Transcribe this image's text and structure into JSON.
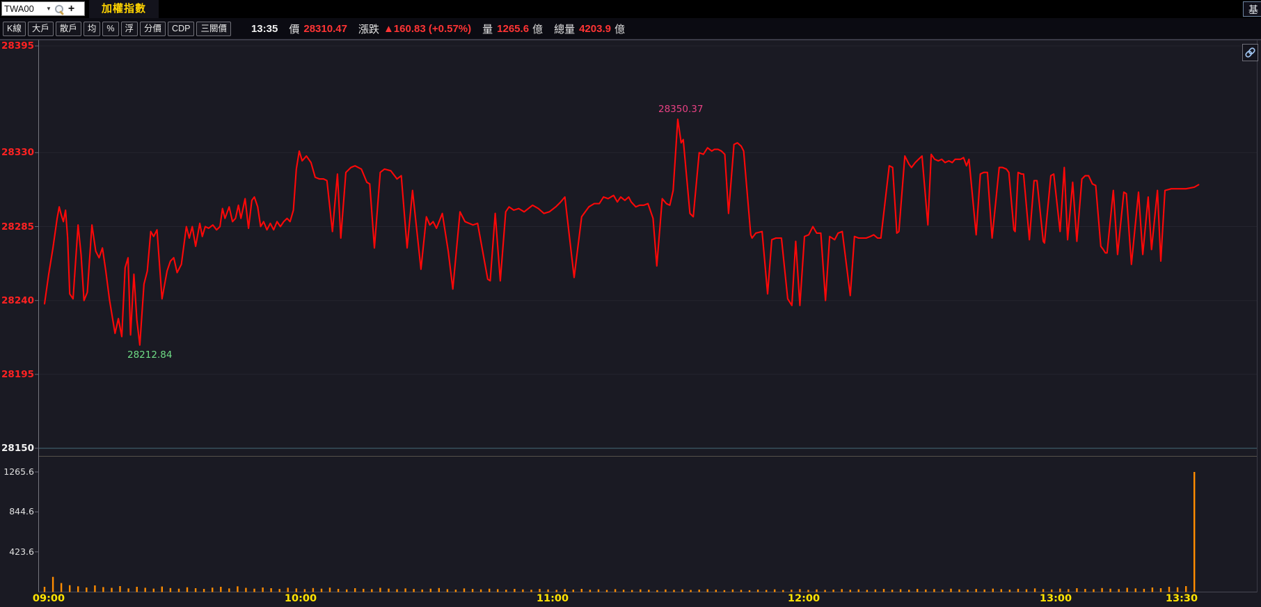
{
  "symbol_bar": {
    "symbol": "TWA00",
    "tab_label": "加權指數",
    "corner_button_label": "基"
  },
  "icons": {
    "caret": "▼",
    "plus": "+"
  },
  "toolbar": {
    "buttons": [
      "K線",
      "大戶",
      "散戶",
      "均",
      "%",
      "浮",
      "分價",
      "CDP",
      "三關價"
    ]
  },
  "quote_bar": {
    "time": "13:35",
    "price_label": "價",
    "price": "28310.47",
    "change_label": "漲跌",
    "change": "▲160.83 (+0.57%)",
    "vol_label": "量",
    "vol_value": "1265.6",
    "vol_unit": "億",
    "total_label": "總量",
    "total_value": "4203.9",
    "total_unit": "億"
  },
  "colors": {
    "background": "#1a1a23",
    "price_line": "#ff0808",
    "grid_line": "#24242e",
    "prev_close_line": "#3e5c68",
    "separator_line": "#56524a",
    "left_axis": "#76767e",
    "frame_line": "#3a3a46",
    "bottom_axis": "#4a4a54",
    "volume_bar": "#ff8c00",
    "price_tick_text": "#ff2222",
    "prev_close_text": "#f2f2f2",
    "volume_tick_text": "#e0e0e0",
    "time_tick_text": "#ffe400",
    "high_text": "#e84183",
    "low_text": "#6fdd86",
    "quote_value": "#ff3434"
  },
  "chart_data": {
    "type": "line",
    "title": "加權指數 (TWA00) 即時走勢",
    "x_axis": {
      "tick_labels": [
        "09:00",
        "10:00",
        "11:00",
        "12:00",
        "13:00",
        "13:30"
      ],
      "tick_minutes": [
        0,
        60,
        120,
        180,
        240,
        270
      ],
      "range_minutes": [
        0,
        275
      ]
    },
    "y_axis": {
      "tick_values": [
        28395,
        28330,
        28285,
        28240,
        28195
      ],
      "prev_close": 28150,
      "range": [
        28150,
        28395
      ],
      "grid": true
    },
    "volume_axis": {
      "tick_values": [
        1265.6,
        844.6,
        423.6
      ],
      "unit": "億"
    },
    "high_annotation": {
      "minute": 150.9,
      "value": 28350.37,
      "label": "28350.37"
    },
    "low_annotation": {
      "minute": 22.7,
      "value": 28212.84,
      "label": "28212.84"
    },
    "last": {
      "time": "13:35",
      "value": 28310.47
    },
    "price_series": [
      [
        0,
        28238
      ],
      [
        1,
        28256
      ],
      [
        2,
        28272
      ],
      [
        3,
        28290
      ],
      [
        3.5,
        28297
      ],
      [
        4,
        28292
      ],
      [
        4.5,
        28288
      ],
      [
        5,
        28295
      ],
      [
        5.5,
        28278
      ],
      [
        6,
        28244
      ],
      [
        6.8,
        28241
      ],
      [
        8,
        28286
      ],
      [
        8.7,
        28268
      ],
      [
        9.4,
        28240
      ],
      [
        10.2,
        28245
      ],
      [
        11.3,
        28286
      ],
      [
        12.2,
        28270
      ],
      [
        13,
        28266
      ],
      [
        13.8,
        28272
      ],
      [
        14.6,
        28258
      ],
      [
        15.5,
        28240
      ],
      [
        16.8,
        28220
      ],
      [
        17.6,
        28229
      ],
      [
        18.4,
        28218
      ],
      [
        19.2,
        28260
      ],
      [
        19.9,
        28266
      ],
      [
        20.5,
        28219
      ],
      [
        21.3,
        28256
      ],
      [
        22,
        28228
      ],
      [
        22.7,
        28212.84
      ],
      [
        23.7,
        28250
      ],
      [
        24.5,
        28258
      ],
      [
        25.3,
        28282
      ],
      [
        26,
        28279
      ],
      [
        26.8,
        28283
      ],
      [
        28,
        28241
      ],
      [
        29.2,
        28258
      ],
      [
        30,
        28264
      ],
      [
        30.8,
        28266
      ],
      [
        31.6,
        28257
      ],
      [
        32.6,
        28262
      ],
      [
        33.8,
        28285
      ],
      [
        34.5,
        28278
      ],
      [
        35.2,
        28285
      ],
      [
        36,
        28273
      ],
      [
        37,
        28287
      ],
      [
        37.6,
        28279
      ],
      [
        38.3,
        28285
      ],
      [
        39.1,
        28284
      ],
      [
        40.1,
        28286
      ],
      [
        41,
        28283
      ],
      [
        41.8,
        28285
      ],
      [
        42.4,
        28296
      ],
      [
        43,
        28290
      ],
      [
        44,
        28297
      ],
      [
        44.8,
        28288
      ],
      [
        45.5,
        28290
      ],
      [
        46.2,
        28298
      ],
      [
        46.8,
        28290
      ],
      [
        47.8,
        28302
      ],
      [
        48.6,
        28284
      ],
      [
        49.4,
        28301
      ],
      [
        50,
        28303
      ],
      [
        50.8,
        28297
      ],
      [
        51.5,
        28285
      ],
      [
        52.2,
        28288
      ],
      [
        53,
        28283
      ],
      [
        53.8,
        28287
      ],
      [
        54.6,
        28283
      ],
      [
        55.4,
        28288
      ],
      [
        56.2,
        28285
      ],
      [
        57,
        28288
      ],
      [
        57.8,
        28290
      ],
      [
        58.5,
        28288
      ],
      [
        59.3,
        28295
      ],
      [
        60,
        28320
      ],
      [
        60.7,
        28331
      ],
      [
        61.4,
        28325
      ],
      [
        62.4,
        28328
      ],
      [
        63.5,
        28324
      ],
      [
        64.5,
        28315
      ],
      [
        65.5,
        28314
      ],
      [
        66.5,
        28314
      ],
      [
        67.3,
        28313
      ],
      [
        68.6,
        28282
      ],
      [
        69.8,
        28317
      ],
      [
        70.6,
        28278
      ],
      [
        71.8,
        28318
      ],
      [
        73,
        28321
      ],
      [
        74,
        28322
      ],
      [
        75.5,
        28320
      ],
      [
        76.8,
        28312
      ],
      [
        77.5,
        28311
      ],
      [
        78.6,
        28272
      ],
      [
        80,
        28318
      ],
      [
        81,
        28320
      ],
      [
        82.5,
        28319
      ],
      [
        84,
        28314
      ],
      [
        85,
        28316
      ],
      [
        86.4,
        28272
      ],
      [
        87.7,
        28307
      ],
      [
        89.7,
        28259
      ],
      [
        91,
        28291
      ],
      [
        91.8,
        28286
      ],
      [
        92.6,
        28288
      ],
      [
        93.4,
        28284
      ],
      [
        94.8,
        28293
      ],
      [
        96.2,
        28270
      ],
      [
        97.3,
        28247
      ],
      [
        99,
        28294
      ],
      [
        100.2,
        28288
      ],
      [
        102.1,
        28286
      ],
      [
        103.2,
        28287
      ],
      [
        105.6,
        28253
      ],
      [
        106.2,
        28252
      ],
      [
        107.4,
        28293
      ],
      [
        108.6,
        28252
      ],
      [
        109.9,
        28294
      ],
      [
        110.7,
        28297
      ],
      [
        111.8,
        28295
      ],
      [
        113,
        28296
      ],
      [
        114.3,
        28294
      ],
      [
        116.3,
        28298
      ],
      [
        117.7,
        28296
      ],
      [
        119,
        28293
      ],
      [
        120.3,
        28294
      ],
      [
        121.8,
        28297
      ],
      [
        123,
        28300
      ],
      [
        124,
        28303
      ],
      [
        126.2,
        28254
      ],
      [
        128,
        28291
      ],
      [
        129.7,
        28297
      ],
      [
        131,
        28299
      ],
      [
        132.2,
        28299
      ],
      [
        133.2,
        28303
      ],
      [
        134.3,
        28302
      ],
      [
        135.6,
        28304
      ],
      [
        136.5,
        28300
      ],
      [
        137.3,
        28303
      ],
      [
        138.3,
        28301
      ],
      [
        139.2,
        28303
      ],
      [
        139.8,
        28300
      ],
      [
        140.9,
        28297
      ],
      [
        141.8,
        28298
      ],
      [
        142.8,
        28298
      ],
      [
        143.8,
        28299
      ],
      [
        145,
        28290
      ],
      [
        145.9,
        28261
      ],
      [
        147.2,
        28302
      ],
      [
        148.2,
        28299
      ],
      [
        149,
        28298
      ],
      [
        149.8,
        28307
      ],
      [
        150.9,
        28350.37
      ],
      [
        151.7,
        28336
      ],
      [
        152.2,
        28338
      ],
      [
        153.8,
        28293
      ],
      [
        154.6,
        28291
      ],
      [
        156,
        28330
      ],
      [
        157,
        28329
      ],
      [
        158,
        28333
      ],
      [
        159,
        28331
      ],
      [
        159.6,
        28332
      ],
      [
        160.5,
        28332
      ],
      [
        161.3,
        28331
      ],
      [
        162.1,
        28329
      ],
      [
        163,
        28293
      ],
      [
        164.3,
        28335
      ],
      [
        165.1,
        28336
      ],
      [
        166,
        28334
      ],
      [
        166.6,
        28331
      ],
      [
        168.3,
        28280
      ],
      [
        168.6,
        28278
      ],
      [
        169.5,
        28281
      ],
      [
        171,
        28282
      ],
      [
        172.3,
        28244
      ],
      [
        173.3,
        28277
      ],
      [
        174.3,
        28278
      ],
      [
        175.6,
        28278
      ],
      [
        177.1,
        28241
      ],
      [
        178.1,
        28237
      ],
      [
        179,
        28276
      ],
      [
        180,
        28237
      ],
      [
        181.1,
        28279
      ],
      [
        182.1,
        28280
      ],
      [
        183.1,
        28285
      ],
      [
        184,
        28281
      ],
      [
        185,
        28281
      ],
      [
        186.1,
        28240
      ],
      [
        187.1,
        28279
      ],
      [
        188.3,
        28277
      ],
      [
        189.1,
        28281
      ],
      [
        190.1,
        28282
      ],
      [
        192,
        28243
      ],
      [
        193,
        28279
      ],
      [
        194,
        28278
      ],
      [
        195,
        28278
      ],
      [
        195.8,
        28278
      ],
      [
        196.8,
        28279
      ],
      [
        197.6,
        28280
      ],
      [
        198.5,
        28278
      ],
      [
        199.3,
        28278
      ],
      [
        201.3,
        28322
      ],
      [
        202.1,
        28321
      ],
      [
        203.1,
        28281
      ],
      [
        203.6,
        28282
      ],
      [
        205,
        28328
      ],
      [
        206,
        28323
      ],
      [
        206.6,
        28321
      ],
      [
        207.5,
        28324
      ],
      [
        208.3,
        28326
      ],
      [
        209.1,
        28328
      ],
      [
        210.5,
        28286
      ],
      [
        211.3,
        28329
      ],
      [
        212.1,
        28326
      ],
      [
        213,
        28325
      ],
      [
        213.8,
        28326
      ],
      [
        214.6,
        28324
      ],
      [
        215.5,
        28325
      ],
      [
        216.3,
        28324
      ],
      [
        217,
        28326
      ],
      [
        218.3,
        28326
      ],
      [
        219,
        28327
      ],
      [
        219.7,
        28322
      ],
      [
        220.3,
        28326
      ],
      [
        222,
        28280
      ],
      [
        223,
        28317
      ],
      [
        223.8,
        28318
      ],
      [
        224.7,
        28318
      ],
      [
        225.8,
        28278
      ],
      [
        227.5,
        28321
      ],
      [
        228.3,
        28321
      ],
      [
        229.2,
        28320
      ],
      [
        229.8,
        28318
      ],
      [
        231,
        28283
      ],
      [
        231.3,
        28282
      ],
      [
        232,
        28318
      ],
      [
        232.8,
        28317
      ],
      [
        233.3,
        28317
      ],
      [
        234.7,
        28277
      ],
      [
        235.8,
        28313
      ],
      [
        236.5,
        28313
      ],
      [
        238,
        28276
      ],
      [
        238.3,
        28275
      ],
      [
        239.8,
        28316
      ],
      [
        240.5,
        28317
      ],
      [
        242,
        28282
      ],
      [
        243,
        28321
      ],
      [
        243.8,
        28277
      ],
      [
        245,
        28312
      ],
      [
        246,
        28276
      ],
      [
        247.2,
        28314
      ],
      [
        248,
        28316
      ],
      [
        248.8,
        28316
      ],
      [
        249.7,
        28311
      ],
      [
        250.5,
        28310
      ],
      [
        251.7,
        28273
      ],
      [
        252.3,
        28271
      ],
      [
        252.8,
        28269
      ],
      [
        253.2,
        28269
      ],
      [
        254.7,
        28307
      ],
      [
        255.7,
        28268
      ],
      [
        257.2,
        28306
      ],
      [
        257.8,
        28305
      ],
      [
        259,
        28262
      ],
      [
        260.7,
        28306
      ],
      [
        261.7,
        28268
      ],
      [
        263,
        28303
      ],
      [
        263.8,
        28271
      ],
      [
        265.2,
        28307
      ],
      [
        266,
        28264
      ],
      [
        267,
        28307
      ],
      [
        268.5,
        28308
      ],
      [
        270,
        28308
      ],
      [
        272,
        28308
      ],
      [
        274,
        28309
      ],
      [
        275,
        28310.47
      ]
    ],
    "volume_series": {
      "start_minute": 0,
      "step_minutes": 2,
      "values": [
        55,
        160,
        95,
        72,
        60,
        48,
        70,
        52,
        44,
        62,
        38,
        55,
        45,
        36,
        58,
        42,
        35,
        50,
        40,
        33,
        46,
        55,
        38,
        60,
        44,
        35,
        48,
        40,
        32,
        45,
        38,
        30,
        42,
        35,
        46,
        33,
        28,
        40,
        34,
        30,
        44,
        36,
        29,
        38,
        32,
        27,
        35,
        42,
        30,
        26,
        38,
        32,
        28,
        35,
        30,
        25,
        33,
        28,
        24,
        32,
        27,
        23,
        30,
        26,
        33,
        24,
        28,
        22,
        30,
        25,
        21,
        28,
        24,
        20,
        27,
        23,
        28,
        22,
        26,
        30,
        24,
        20,
        27,
        23,
        19,
        26,
        22,
        28,
        21,
        25,
        30,
        23,
        27,
        22,
        26,
        31,
        24,
        28,
        23,
        27,
        32,
        25,
        29,
        24,
        33,
        27,
        31,
        25,
        35,
        28,
        24,
        32,
        27,
        36,
        30,
        26,
        34,
        29,
        38,
        31,
        27,
        36,
        30,
        40,
        33,
        29,
        42,
        35,
        31,
        45,
        38,
        34,
        48,
        40,
        55,
        50,
        62,
        1265.6
      ]
    }
  }
}
